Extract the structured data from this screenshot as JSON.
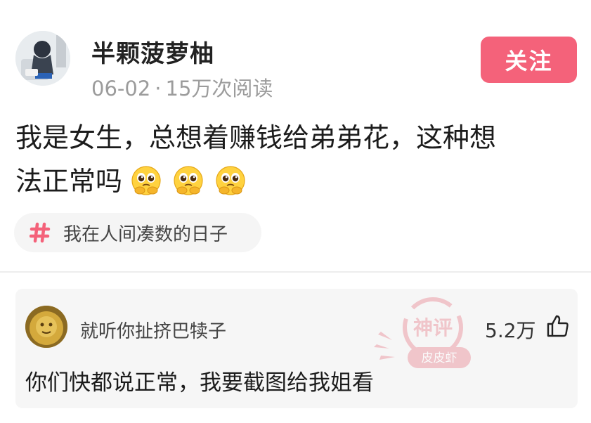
{
  "post": {
    "author": "半颗菠萝柚",
    "date": "06-02",
    "separator": "·",
    "reads": "15万次阅读",
    "follow_label": "关注",
    "text_line1": "我是女生，总想着赚钱给弟弟花，这种想",
    "text_line2": "法正常吗",
    "emoji_icon": "pleading-face-icon",
    "emoji_count": 3,
    "topic": "我在人间凑数的日子"
  },
  "comment": {
    "username": "就听你扯挤巴犊子",
    "likes": "5.2万",
    "text": "你们快都说正常，我要截图给我姐看"
  },
  "watermark": {
    "line1": "神评",
    "line2": "皮皮虾"
  },
  "colors": {
    "accent": "#f4627a",
    "meta_gray": "#9c9c9c",
    "card_bg": "#f6f6f6"
  }
}
